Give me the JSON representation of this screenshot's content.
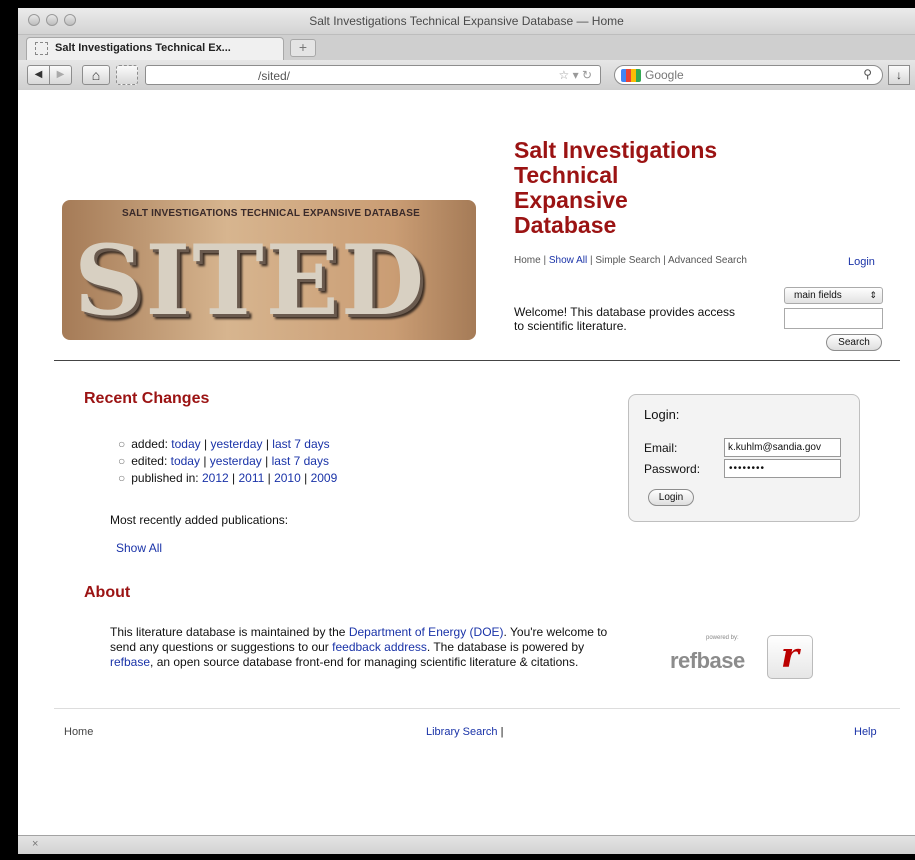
{
  "browser": {
    "window_title": "Salt Investigations Technical Expansive Database — Home",
    "tab_title": "Salt Investigations Technical Ex...",
    "new_tab": "+",
    "url": "/sited/",
    "search_engine": "Google",
    "status_icon": "×"
  },
  "header": {
    "banner_top": "SALT INVESTIGATIONS TECHNICAL EXPANSIVE DATABASE",
    "banner_big": "SITED",
    "title_lines": [
      "Salt Investigations",
      "Technical",
      "Expansive",
      "Database"
    ],
    "nav": {
      "home": "Home",
      "sep": " | ",
      "show_all": "Show All",
      "simple_search": "Simple Search",
      "advanced_search": "Advanced Search"
    },
    "login_link": "Login",
    "welcome": "Welcome! This database provides access to scientific literature.",
    "quick_search_select": "main fields",
    "search_button": "Search"
  },
  "recent_changes": {
    "heading": "Recent Changes",
    "sep": " | ",
    "added_label": "added: ",
    "edited_label": "edited: ",
    "published_label": "published in: ",
    "today": "today",
    "yesterday": "yesterday",
    "last7": "last 7 days",
    "years": [
      "2012",
      "2011",
      "2010",
      "2009"
    ],
    "recent_note": "Most recently added publications:",
    "show_all": "Show All"
  },
  "login_box": {
    "title": "Login:",
    "email_label": "Email:",
    "email_value": "k.kuhlm@sandia.gov",
    "password_label": "Password:",
    "password_value": "••••••••",
    "button": "Login"
  },
  "about": {
    "heading": "About",
    "t1": "This literature database is maintained by the ",
    "doe": "Department of Energy (DOE)",
    "t2": ". You're welcome to send any questions or suggestions to our ",
    "feedback": "feedback address",
    "t3": ". The database is powered by ",
    "refbase": "refbase",
    "t4": ", an open source database front-end for managing scientific literature & citations.",
    "logo_powered": "powered by:",
    "logo_word": "refbase",
    "logo_r": "r"
  },
  "footer": {
    "home": "Home",
    "library_search": "Library Search",
    "lib_sep": " |",
    "help": "Help"
  }
}
